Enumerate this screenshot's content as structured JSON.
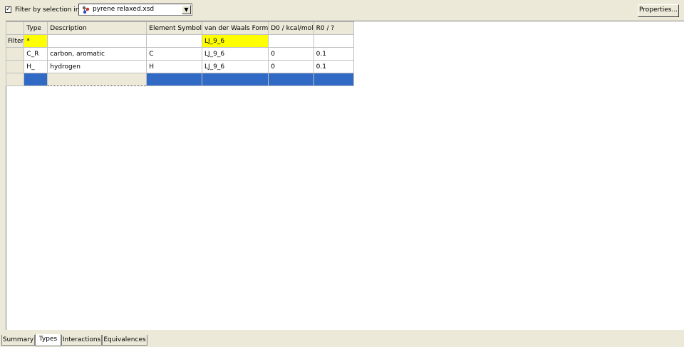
{
  "toolbar": {
    "filter_checked": true,
    "filter_label": "Filter by selection in:",
    "combo_value": "pyrene relaxed.xsd",
    "combo_icon": "molecule-icon",
    "properties_label": "Properties..."
  },
  "grid": {
    "columns": [
      "Type",
      "Description",
      "Element Symbol",
      "van der Waals Form",
      "D0 / kcal/mol",
      "R0 / ?"
    ],
    "filter_row": {
      "label": "Filter",
      "cells": [
        "*",
        "",
        "",
        "LJ_9_6",
        "",
        ""
      ]
    },
    "rows": [
      [
        "C_R",
        "carbon, aromatic",
        "C",
        "LJ_9_6",
        "0",
        "0.1"
      ],
      [
        "H_",
        "hydrogen",
        "H",
        "LJ_9_6",
        "0",
        "0.1"
      ]
    ]
  },
  "tabs": [
    {
      "label": "Summary",
      "active": false
    },
    {
      "label": "Types",
      "active": true
    },
    {
      "label": "Interactions",
      "active": false
    },
    {
      "label": "Equivalences",
      "active": false
    }
  ],
  "colors": {
    "highlight": "#ffff00",
    "selection": "#316ac5",
    "face": "#ece9d8"
  }
}
